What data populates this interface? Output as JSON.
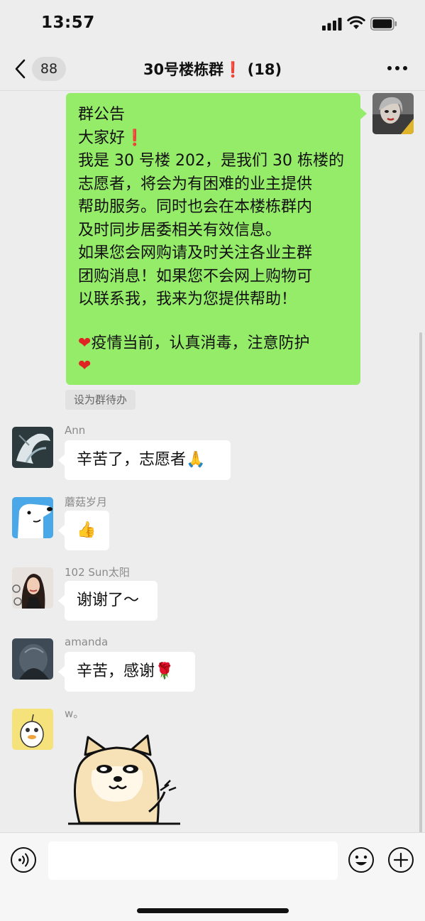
{
  "status_bar": {
    "time": "13:57"
  },
  "nav": {
    "unread_count": "88",
    "title": "30号楼栋群❗ (18)"
  },
  "announcement": {
    "lines": [
      "群公告",
      "大家好",
      "我是 30 号楼 202，是我们 30 栋楼的",
      "志愿者，将会为有困难的业主提供",
      "帮助服务。同时也会在本楼栋群内",
      "及时同步居委相关有效信息。",
      "如果您会网购请及时关注各业主群",
      "团购消息！如果您不会网上购物可",
      "以联系我，我来为您提供帮助！",
      "疫情当前，认真消毒，注意防护"
    ],
    "todo_label": "设为群待办"
  },
  "messages": [
    {
      "sender": "Ann",
      "text": "辛苦了，志愿者",
      "emoji": "🙏"
    },
    {
      "sender": "蘑菇岁月",
      "text": "",
      "emoji": "👍"
    },
    {
      "sender": "102 Sun太阳",
      "text": "谢谢了～",
      "emoji": ""
    },
    {
      "sender": "amanda",
      "text": "辛苦，感谢",
      "emoji": "🌹"
    },
    {
      "sender": "w。",
      "text": "",
      "emoji": ""
    }
  ],
  "icons": {
    "back": "chevron-left-icon",
    "more": "more-icon",
    "voice": "voice-icon",
    "emoji": "emoji-icon",
    "plus": "plus-icon"
  },
  "colors": {
    "bubble_self": "#95ec69",
    "bubble_other": "#ffffff",
    "background": "#ededed"
  }
}
